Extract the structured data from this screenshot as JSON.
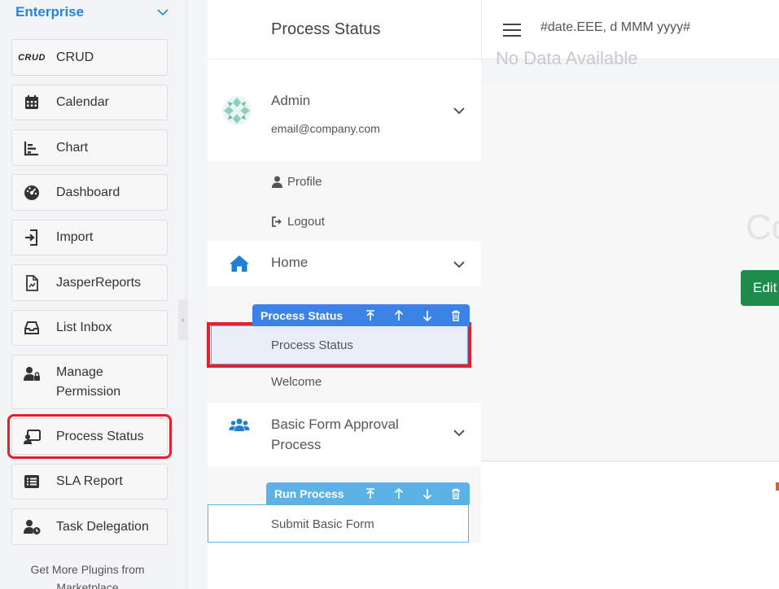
{
  "palette": {
    "category": "Enterprise",
    "items": [
      {
        "label": "CRUD",
        "icon": "crud-icon",
        "icon_text": "CRUD"
      },
      {
        "label": "Calendar",
        "icon": "calendar-icon"
      },
      {
        "label": "Chart",
        "icon": "chart-icon"
      },
      {
        "label": "Dashboard",
        "icon": "dashboard-icon"
      },
      {
        "label": "Import",
        "icon": "import-icon"
      },
      {
        "label": "JasperReports",
        "icon": "report-file-icon"
      },
      {
        "label": "List Inbox",
        "icon": "inbox-icon"
      },
      {
        "label": "Manage Permission",
        "icon": "user-lock-icon"
      },
      {
        "label": "Process Status",
        "icon": "process-status-icon",
        "selected": true
      },
      {
        "label": "SLA Report",
        "icon": "list-icon"
      },
      {
        "label": "Task Delegation",
        "icon": "user-clock-icon"
      }
    ],
    "more_plugins": "Get More Plugins from Marketplace"
  },
  "menu": {
    "brand": "Process Status",
    "user": {
      "name": "Admin",
      "email": "email@company.com"
    },
    "user_links": {
      "profile": "Profile",
      "logout": "Logout"
    },
    "categories": [
      {
        "label": "Home",
        "icon": "home-icon",
        "items": [
          "Process Status",
          "Welcome"
        ],
        "toolbar_title": "Process Status"
      },
      {
        "label": "Basic Form Approval Process",
        "icon": "users-icon",
        "items": [
          "Submit Basic Form"
        ],
        "toolbar_title": "Run Process"
      }
    ]
  },
  "topbar": {
    "date_format": "#date.EEE, d MMM yyyy#"
  },
  "preview": {
    "no_data": "No Data Available",
    "big_text": "Co",
    "edit_button": "Edit"
  },
  "colors": {
    "accent": "#2a83d6",
    "toolbar_dark": "#3b82e6",
    "toolbar_light": "#5ab2e6",
    "highlight": "#e4202e",
    "edit_green": "#1e8a4b"
  }
}
